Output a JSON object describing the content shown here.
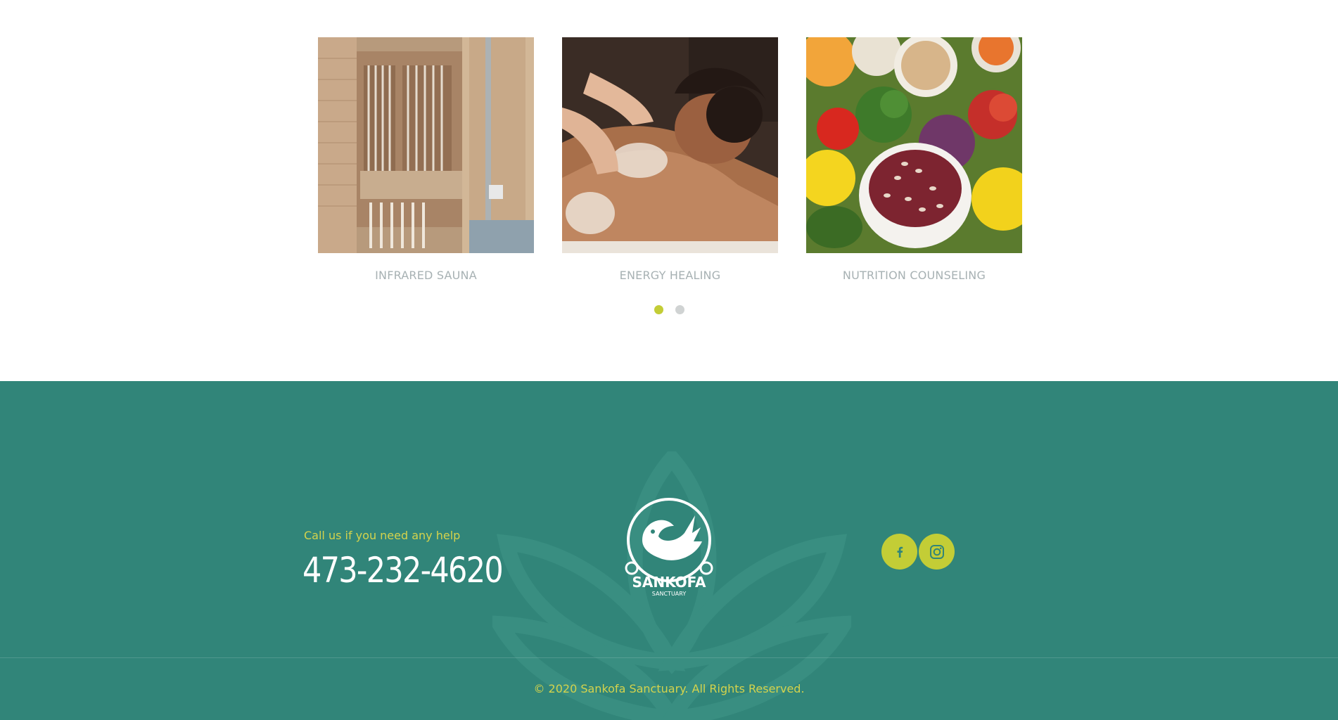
{
  "services": {
    "cards": [
      {
        "title": "INFRARED SAUNA",
        "image": "infrared-sauna-photo"
      },
      {
        "title": "ENERGY HEALING",
        "image": "massage-scrub-photo"
      },
      {
        "title": "NUTRITION COUNSELING",
        "image": "vegetables-beans-photo"
      }
    ],
    "pagination": {
      "pages": 2,
      "active": 1
    }
  },
  "footer": {
    "help_label": "Call us if you need any help",
    "phone": "473-232-4620",
    "logo": {
      "name": "SANKOFA",
      "subtitle": "SANCTUARY"
    },
    "social": [
      {
        "network": "facebook",
        "icon": "facebook-icon"
      },
      {
        "network": "instagram",
        "icon": "instagram-icon"
      }
    ],
    "copyright": "© 2020 Sankofa Sanctuary. All Rights Reserved."
  },
  "colors": {
    "footer_bg": "#318579",
    "accent_green": "#c3cd36",
    "accent_yellow_text": "#d4d34c",
    "card_title_grey": "#a7b1b3",
    "dot_inactive": "#d0d3d3"
  }
}
